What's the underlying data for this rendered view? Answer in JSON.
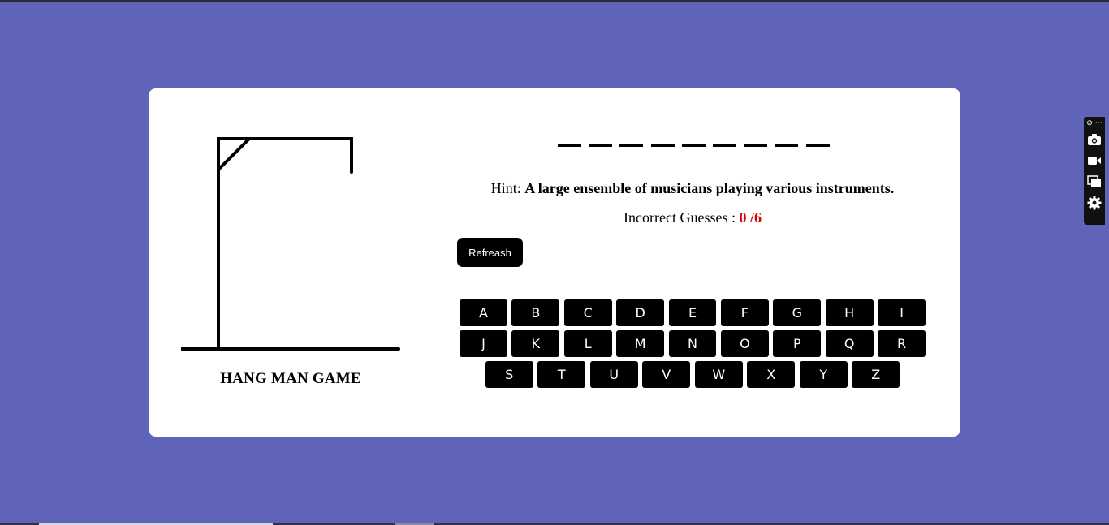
{
  "game": {
    "title": "HANG MAN GAME",
    "word_blanks": [
      "",
      "",
      "",
      "",
      "",
      "",
      "",
      "",
      ""
    ],
    "hint_label": "Hint:",
    "hint_text": "A large ensemble of musicians playing various instruments.",
    "incorrect_label": "Incorrect Guesses :",
    "incorrect_count": "0 /6",
    "refresh_label": "Refreash"
  },
  "keyboard": {
    "row1": [
      "A",
      "B",
      "C",
      "D",
      "E",
      "F",
      "G",
      "H",
      "I"
    ],
    "row2": [
      "J",
      "K",
      "L",
      "M",
      "N",
      "O",
      "P",
      "Q",
      "R"
    ],
    "row3": [
      "S",
      "T",
      "U",
      "V",
      "W",
      "X",
      "Y",
      "Z"
    ]
  },
  "sidebar": {
    "top_glyph": "⊘ ⋯",
    "icons": [
      "camera-icon",
      "video-icon",
      "windows-icon",
      "gear-icon"
    ]
  },
  "colors": {
    "background": "#5f64b9",
    "card": "#ffffff",
    "key": "#000000",
    "incorrect_count": "#e00000"
  }
}
